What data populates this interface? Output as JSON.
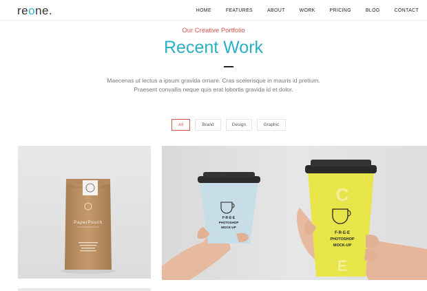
{
  "header": {
    "logo": {
      "prefix": "re",
      "accent": "o",
      "suffix": "ne."
    },
    "nav": [
      "HOME",
      "FEATURES",
      "ABOUT",
      "WORK",
      "PRICING",
      "BLOG",
      "CONTACT"
    ]
  },
  "section": {
    "subtitle": "Our Creative Portfolio",
    "title": "Recent Work",
    "description_line1": "Maecenas ut lectus a ipsum gravida ornare. Cras scelerisque in mauris id pretium.",
    "description_line2": "Praesent convallis neque quis erat lobortis gravida id et dolor."
  },
  "filters": [
    {
      "label": "All",
      "active": true
    },
    {
      "label": "Brand",
      "active": false
    },
    {
      "label": "Design",
      "active": false
    },
    {
      "label": "Graphic",
      "active": false
    }
  ],
  "portfolio": {
    "pouch": {
      "brand": "PaperPouch"
    },
    "cups": {
      "text1": "F·R·E·E",
      "text2": "PHOTOSHOP",
      "text3": "MOCK-UP"
    }
  },
  "colors": {
    "accent": "#29b0c7",
    "highlight": "#d9534f"
  }
}
